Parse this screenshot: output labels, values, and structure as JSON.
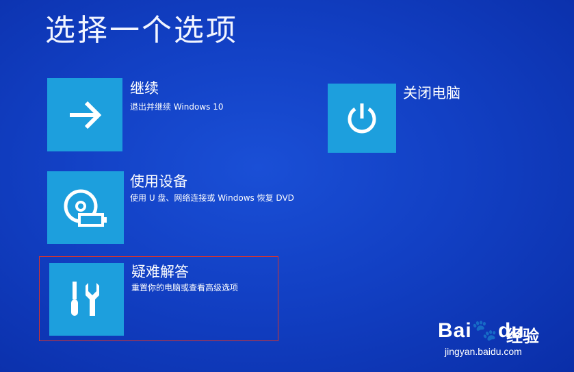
{
  "page_title": "选择一个选项",
  "options": [
    {
      "title": "继续",
      "description": "退出并继续 Windows 10",
      "icon": "arrow-right-icon"
    },
    {
      "title": "使用设备",
      "description": "使用 U 盘、网络连接或 Windows 恢复 DVD",
      "icon": "disc-drive-icon"
    },
    {
      "title": "疑难解答",
      "description": "重置你的电脑或查看高级选项",
      "icon": "tools-icon"
    },
    {
      "title": "关闭电脑",
      "icon": "power-icon"
    }
  ],
  "watermark": {
    "logo": "Bai",
    "logo_end": "du",
    "brand": "经验",
    "url": "jingyan.baidu.com"
  },
  "colors": {
    "background": "#1240c4",
    "tile": "#1d9fdd",
    "highlight_border": "#d9342b"
  }
}
